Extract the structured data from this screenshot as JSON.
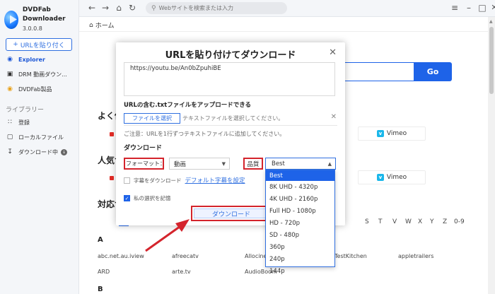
{
  "app": {
    "name": "DVDFab Downloader",
    "version": "3.0.0.8"
  },
  "sidebar": {
    "paste_button": "URLを貼り付く",
    "items": [
      {
        "label": "Explorer",
        "icon": "compass-icon"
      },
      {
        "label": "DRM 動画ダウン...",
        "icon": "drm-icon"
      },
      {
        "label": "DVDFab製品",
        "icon": "dvdfab-icon"
      }
    ],
    "library_title": "ライブラリー",
    "library_items": [
      {
        "label": "登録",
        "icon": "rss-icon"
      },
      {
        "label": "ローカルファイル",
        "icon": "folder-icon"
      },
      {
        "label": "ダウンロード中",
        "icon": "download-icon"
      }
    ]
  },
  "topbar": {
    "search_placeholder": "Webサイトを検索または入力"
  },
  "main": {
    "breadcrumb": "ホーム",
    "go_button": "Go",
    "section_popular_sites": "よく使",
    "section_popular_2": "人気サ",
    "section_supported": "対応サ",
    "tile_vimeo": "Vimeo",
    "alphabet": [
      "S",
      "T",
      "V",
      "W",
      "X",
      "Y",
      "Z",
      "0-9"
    ],
    "group_a": "A",
    "group_b": "B",
    "sites_row1": [
      "abc.net.au.iview",
      "afreecatv",
      "Allocine",
      "cas TestKitchen",
      "appletrailers"
    ],
    "sites_row2": [
      "ARD",
      "arte.tv",
      "AudioBoom"
    ]
  },
  "modal": {
    "title": "URLを貼り付けてダウンロード",
    "url_value": "https://youtu.be/An0bZpuhiBE",
    "upload_label": "URLの含む.txtファイルをアップロードできる",
    "file_button": "ファイルを選択",
    "file_hint": "テキストファイルを選択してください。",
    "note": "ご注意：URLを1行ずつテキストファイルに追加してください。",
    "download_section": "ダウンロード",
    "format_label": "フォーマット：",
    "format_value": "動画",
    "quality_label": "品質",
    "quality_value": "Best",
    "subtitle_check": "字幕をダウンロード",
    "subtitle_link": "デフォルト字幕を設定",
    "remember_check": "私の選択を記憶",
    "download_button": "ダウンロード"
  },
  "quality_options": [
    "Best",
    "8K UHD - 4320p",
    "4K UHD - 2160p",
    "Full HD - 1080p",
    "HD - 720p",
    "SD - 480p",
    "360p",
    "240p",
    "144p"
  ],
  "colors": {
    "accent": "#1e63e8",
    "highlight": "#d4242c"
  }
}
